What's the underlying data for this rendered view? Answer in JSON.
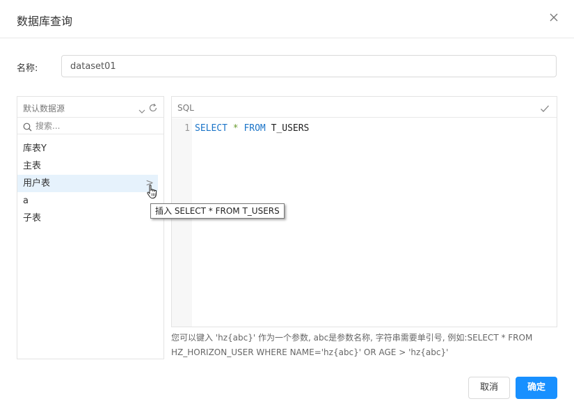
{
  "dialog": {
    "title": "数据库查询"
  },
  "name_field": {
    "label": "名称:",
    "value": "dataset01"
  },
  "datasource": {
    "selected": "默认数据源",
    "search_placeholder": "搜索..."
  },
  "tables": [
    {
      "label": "库表Y"
    },
    {
      "label": "主表"
    },
    {
      "label": "用户表",
      "insert_arrow": ">"
    },
    {
      "label": "a"
    },
    {
      "label": "子表"
    }
  ],
  "tooltip": {
    "text": "插入 SELECT * FROM T_USERS"
  },
  "editor": {
    "language": "SQL",
    "line_number": "1",
    "code": {
      "kw1": "SELECT",
      "star": "*",
      "kw2": "FROM",
      "table": "T_USERS"
    }
  },
  "hint": {
    "text": "您可以键入 'hz{abc}' 作为一个参数, abc是参数名称, 字符串需要单引号, 例如:SELECT * FROM HZ_HORIZON_USER WHERE NAME='hz{abc}' OR AGE > 'hz{abc}'"
  },
  "buttons": {
    "cancel": "取消",
    "ok": "确定"
  },
  "colors": {
    "primary": "#1890ff",
    "selected_row": "#e6f2fc",
    "keyword": "#1a74c8",
    "operator": "#6a9c2f"
  },
  "icons": {
    "close": "close-icon",
    "chevron": "chevron-down-icon",
    "refresh": "refresh-icon",
    "search": "search-icon",
    "check": "check-icon",
    "cursor": "hand-pointer-icon"
  }
}
